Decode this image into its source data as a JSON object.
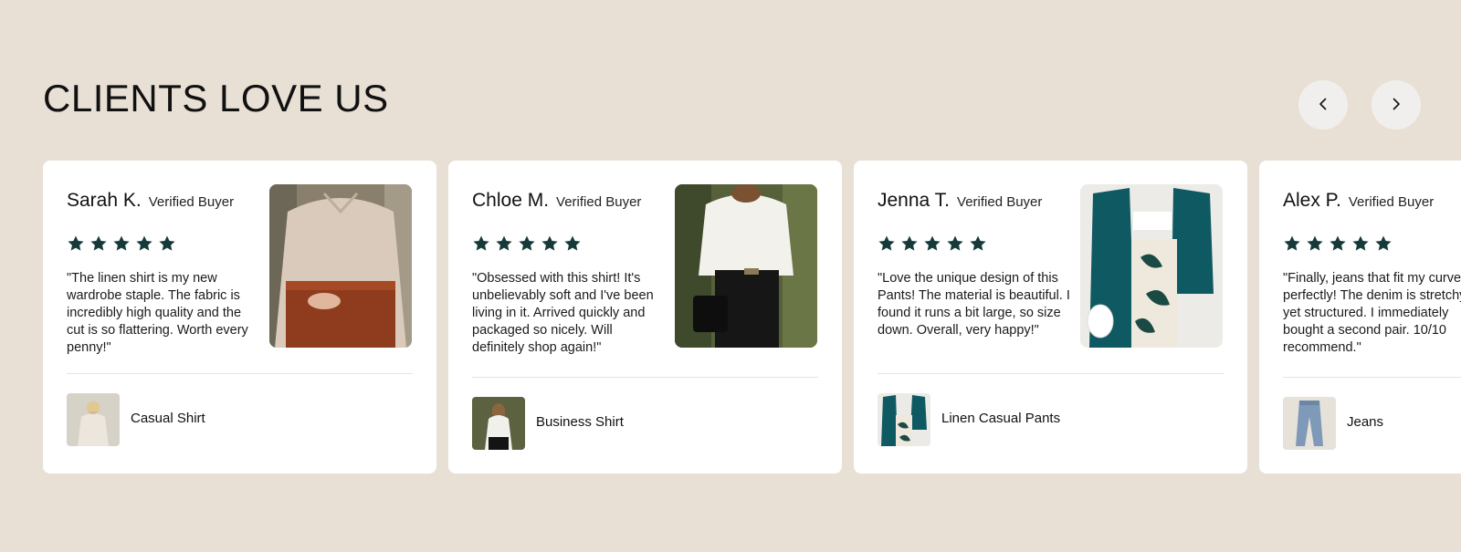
{
  "section": {
    "title": "CLIENTS LOVE US",
    "prev_icon": "chevron-left-icon",
    "next_icon": "chevron-right-icon"
  },
  "colors": {
    "background": "#e8e0d5",
    "card": "#ffffff",
    "star": "#163a3a",
    "nav_button": "#f0efed"
  },
  "reviews": [
    {
      "name": "Sarah K.",
      "badge": "Verified Buyer",
      "rating": 5,
      "text": "\"The linen shirt is my new wardrobe staple. The fabric is incredibly high quality and the cut is so flattering. Worth every penny!\"",
      "product": "Casual Shirt"
    },
    {
      "name": "Chloe M.",
      "badge": "Verified Buyer",
      "rating": 5,
      "text": "\"Obsessed with this shirt! It's unbelievably soft and I've been living in it. Arrived quickly and packaged so nicely. Will definitely shop again!\"",
      "product": "Business Shirt"
    },
    {
      "name": "Jenna T.",
      "badge": "Verified Buyer",
      "rating": 5,
      "text": "\"Love the unique design of this Pants! The material is beautiful. I found it runs a bit large, so size down. Overall, very happy!\"",
      "product": "Linen Casual Pants"
    },
    {
      "name": "Alex P.",
      "badge": "Verified Buyer",
      "rating": 5,
      "text": "\"Finally, jeans that fit my curves perfectly! The denim is stretchy yet structured. I immediately bought a second pair. 10/10 recommend.\"",
      "product": "Jeans"
    }
  ]
}
